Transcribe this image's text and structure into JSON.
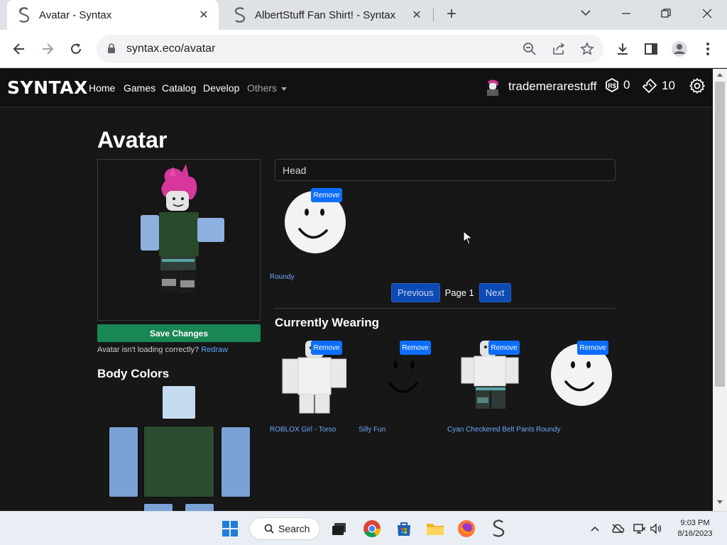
{
  "browser": {
    "tabs": [
      {
        "title": "Avatar - Syntax",
        "active": true
      },
      {
        "title": "AlbertStuff Fan Shirt! - Syntax",
        "active": false
      }
    ],
    "url": "syntax.eco/avatar"
  },
  "site": {
    "brand": "SYNTAX",
    "nav": [
      "Home",
      "Games",
      "Catalog",
      "Develop"
    ],
    "others_label": "Others",
    "username": "trademerarestuff",
    "robux": "0",
    "tix": "10"
  },
  "page": {
    "title": "Avatar",
    "save_label": "Save Changes",
    "loading_note": "Avatar isn't loading correctly?",
    "redraw_label": "Redraw",
    "body_colors_title": "Body Colors",
    "body_colors": {
      "head": "#c4dbef",
      "torso": "#2c4e30",
      "left_arm": "#7ba2d7",
      "right_arm": "#7ba2d7",
      "left_leg": "#7ba2d7",
      "right_leg": "#7ba2d7"
    },
    "category_value": "Head",
    "remove_label": "Remove",
    "inventory": [
      {
        "name": "Roundy",
        "icon": "smiley-head-icon"
      }
    ],
    "pager": {
      "previous": "Previous",
      "page_label": "Page 1",
      "next": "Next"
    },
    "wearing_title": "Currently Wearing",
    "wearing": [
      {
        "name": "ROBLOX Girl - Torso",
        "icon": "torso-icon"
      },
      {
        "name": "Silly Fun",
        "icon": "face-icon"
      },
      {
        "name": "Cyan Checkered Belt Pants",
        "icon": "pants-icon"
      },
      {
        "name": "Roundy",
        "icon": "smiley-head-icon"
      }
    ]
  },
  "taskbar": {
    "search_label": "Search",
    "time": "9:03 PM",
    "date": "8/16/2023"
  }
}
